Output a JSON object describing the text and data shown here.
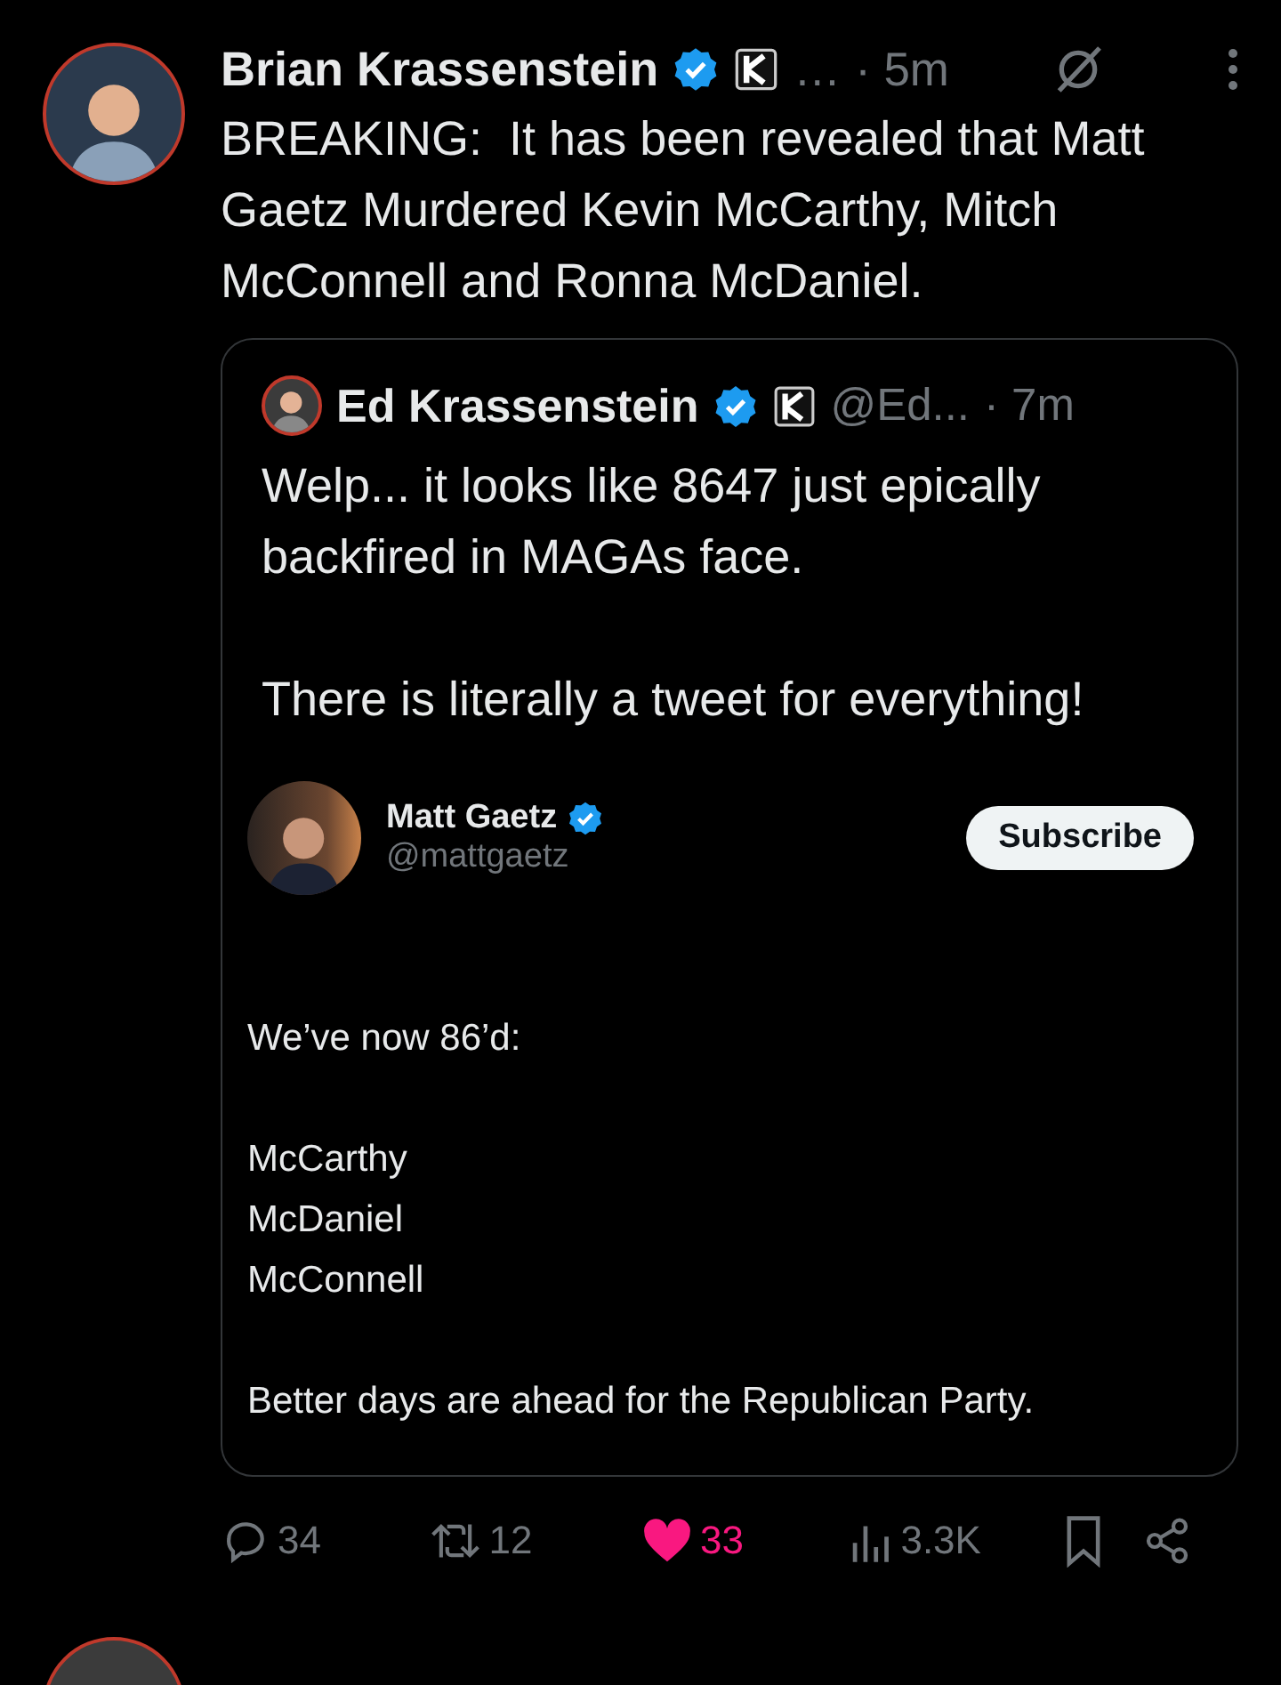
{
  "tweet": {
    "author": {
      "name": "Brian Krassenstein",
      "verified": true,
      "affiliate": true,
      "handle": "…",
      "time": "· 5m"
    },
    "text": "BREAKING:  It has been revealed that Matt Gaetz Murdered Kevin McCarthy, Mitch McConnell and Ronna McDaniel.",
    "quote": {
      "author": {
        "name": "Ed Krassenstein",
        "verified": true,
        "affiliate": true,
        "handle": "@Ed...",
        "time": "· 7m"
      },
      "paragraphs": [
        "Welp... it looks like 8647 just epically backfired in MAGAs face.",
        "There is literally a tweet for everything!"
      ],
      "embedded": {
        "name": "Matt Gaetz",
        "verified": true,
        "handle": "@mattgaetz",
        "button": "Subscribe",
        "paragraphs": [
          [
            "We’ve now 86’d:"
          ],
          [
            "McCarthy",
            "McDaniel",
            "McConnell"
          ],
          [
            "Better days are ahead for the Republican Party."
          ]
        ]
      }
    },
    "actions": [
      {
        "kind": "reply",
        "count": "34",
        "active": false
      },
      {
        "kind": "repost",
        "count": "12",
        "active": false
      },
      {
        "kind": "like",
        "count": "33",
        "active": true
      },
      {
        "kind": "views",
        "count": "3.3K",
        "active": false
      },
      {
        "kind": "bookmark",
        "active": false
      },
      {
        "kind": "share",
        "active": false
      }
    ]
  }
}
